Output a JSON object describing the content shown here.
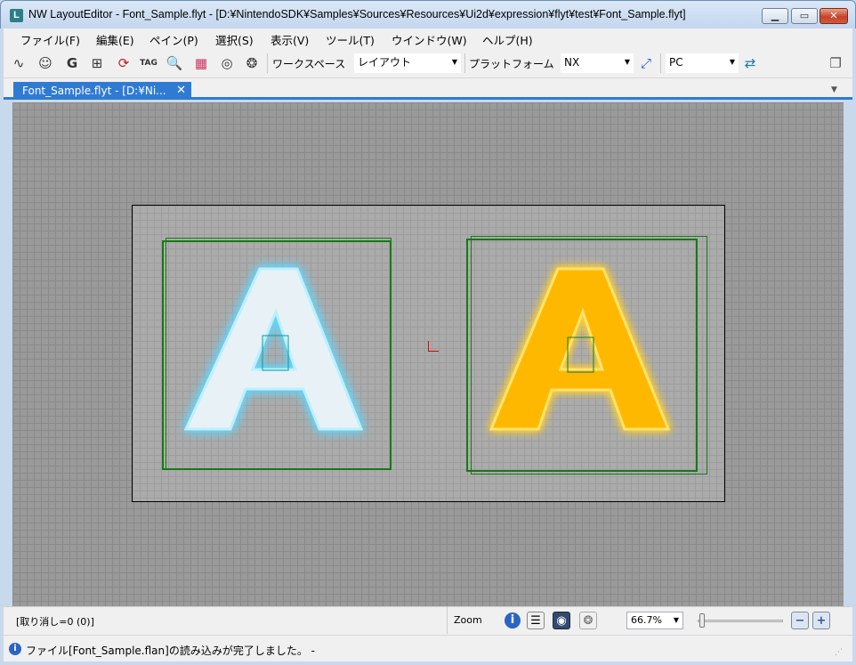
{
  "window": {
    "app_icon": "L",
    "title": "NW LayoutEditor - Font_Sample.flyt - [D:¥NintendoSDK¥Samples¥Sources¥Resources¥Ui2d¥expression¥flyt¥test¥Font_Sample.flyt]",
    "minimize": "▁",
    "maximize": "▭",
    "close": "✕"
  },
  "menu": {
    "items": [
      "ファイル(F)",
      "編集(E)",
      "ペイン(P)",
      "選択(S)",
      "表示(V)",
      "ツール(T)",
      "ウインドウ(W)",
      "ヘルプ(H)"
    ]
  },
  "toolbar": {
    "icons": [
      "curve-editor-icon",
      "smiley-icon",
      "g-icon",
      "hierarchy-icon",
      "refresh-icon",
      "tag-icon",
      "search-icon",
      "color-palette-icon",
      "target-icon",
      "multi-target-icon"
    ],
    "icon_glyphs": [
      "∿",
      "☺",
      "G",
      "⊞",
      "⟳",
      "TAG",
      "🔍",
      "▦",
      "◎",
      "❂"
    ],
    "workspace_label": "ワークスペース",
    "workspace_value": "レイアウト",
    "platform_label": "プラットフォーム",
    "platform_value": "NX",
    "connect_icon": "⤢",
    "target_value": "PC",
    "right_icon": "⇄",
    "window_icon": "❐"
  },
  "tabs": {
    "active_label": "Font_Sample.flyt - [D:¥Ni...",
    "close": "✕",
    "menu": "▼"
  },
  "canvas": {
    "glyph_left": "A",
    "glyph_right": "A",
    "colors": {
      "glow_blue": "#5fd8ff",
      "glow_orange": "#ffb400",
      "pane_green": "#167a16"
    }
  },
  "statusbar": {
    "undo": "[取り消し=0 (0)]",
    "zoom_label": "Zoom",
    "zoom_value": "66.7%",
    "zoom_out": "−",
    "zoom_in": "+"
  },
  "infobar": {
    "icon": "i",
    "message": "ファイル[Font_Sample.flan]の読み込みが完了しました。 -"
  }
}
